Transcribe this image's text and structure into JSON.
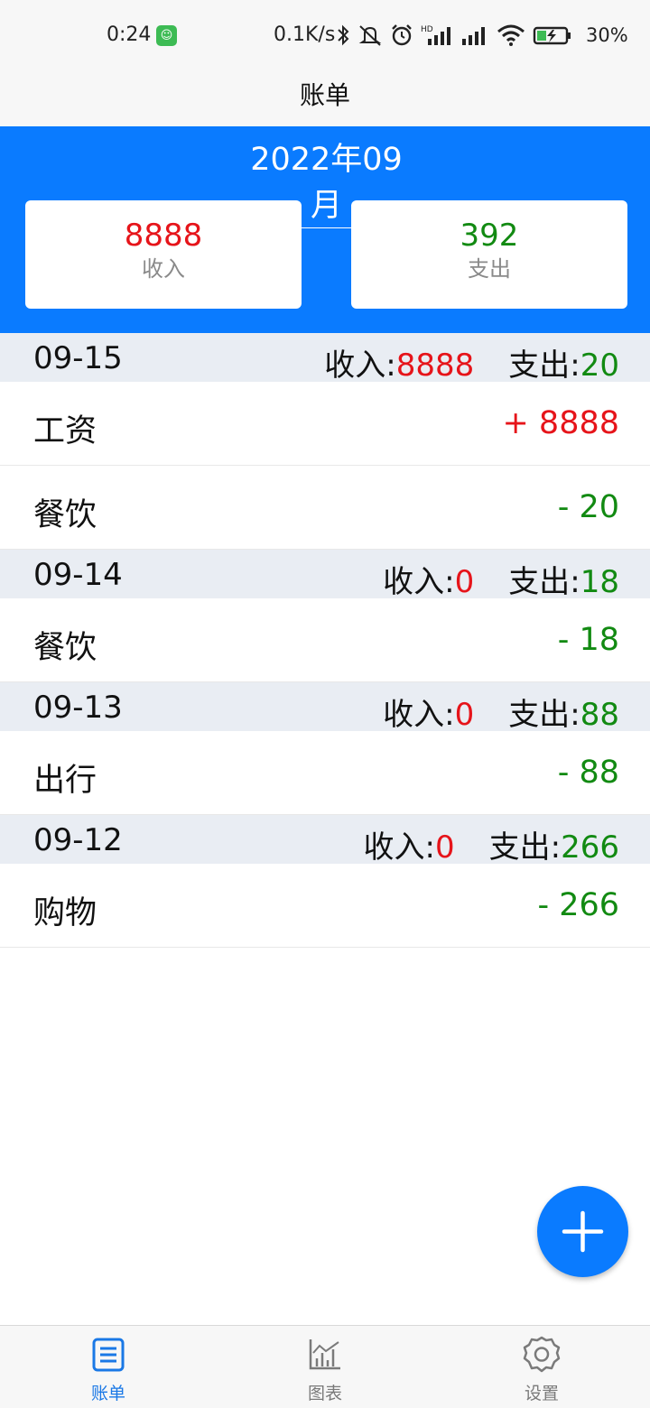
{
  "status_bar": {
    "time": "0:24",
    "net_speed": "0.1K/s",
    "battery": "30%",
    "icons": [
      "app-notification-icon",
      "bluetooth-icon",
      "mute-icon",
      "alarm-icon",
      "hd-signal-icon",
      "signal-icon",
      "wifi-icon",
      "battery-charging-icon"
    ]
  },
  "title": "账单",
  "month": "2022年09月",
  "summary": {
    "income_amount": "8888",
    "income_label": "收入",
    "expense_amount": "392",
    "expense_label": "支出"
  },
  "labels": {
    "income_prefix": "收入:",
    "expense_prefix": "支出:"
  },
  "days": [
    {
      "date": "09-15",
      "income": "8888",
      "expense": "20",
      "items": [
        {
          "category": "工资",
          "amount": "+ 8888",
          "type": "income"
        },
        {
          "category": "餐饮",
          "amount": "- 20",
          "type": "expense"
        }
      ]
    },
    {
      "date": "09-14",
      "income": "0",
      "expense": "18",
      "items": [
        {
          "category": "餐饮",
          "amount": "- 18",
          "type": "expense"
        }
      ]
    },
    {
      "date": "09-13",
      "income": "0",
      "expense": "88",
      "items": [
        {
          "category": "出行",
          "amount": "- 88",
          "type": "expense"
        }
      ]
    },
    {
      "date": "09-12",
      "income": "0",
      "expense": "266",
      "items": [
        {
          "category": "购物",
          "amount": "- 266",
          "type": "expense"
        }
      ]
    }
  ],
  "fab_icon": "plus-icon",
  "nav": {
    "items": [
      {
        "label": "账单",
        "icon": "bill-icon",
        "active": true
      },
      {
        "label": "图表",
        "icon": "chart-icon",
        "active": false
      },
      {
        "label": "设置",
        "icon": "settings-gear-icon",
        "active": false
      }
    ]
  },
  "colors": {
    "primary": "#0a7bff",
    "income": "#e6141a",
    "expense": "#128a12",
    "day_header_bg": "#e9edf3",
    "nav_active": "#1a78e6"
  }
}
